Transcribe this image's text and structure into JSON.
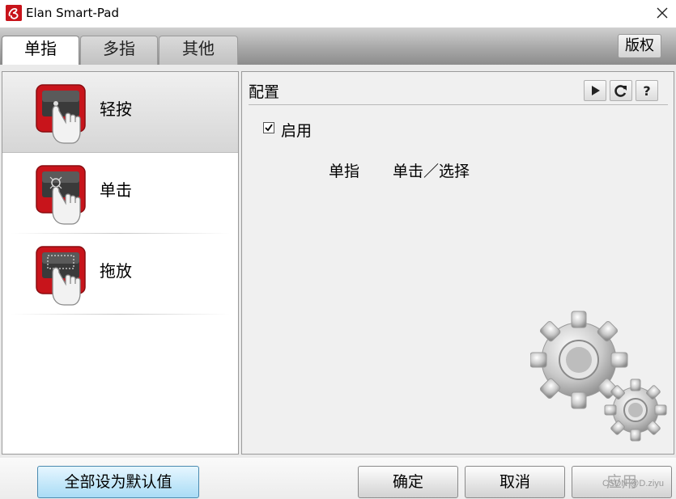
{
  "window": {
    "title": "Elan Smart-Pad",
    "app_icon": "elan-logo-icon",
    "close_icon": "close-icon"
  },
  "tabs": [
    {
      "label": "单指",
      "active": true
    },
    {
      "label": "多指",
      "active": false
    },
    {
      "label": "其他",
      "active": false
    }
  ],
  "copyright_label": "版权",
  "gesture_list": [
    {
      "label": "轻按",
      "icon": "touchpad-tap-icon",
      "selected": true
    },
    {
      "label": "单击",
      "icon": "touchpad-click-icon",
      "selected": false
    },
    {
      "label": "拖放",
      "icon": "touchpad-drag-icon",
      "selected": false
    }
  ],
  "config": {
    "title": "配置",
    "toolbar": [
      {
        "icon": "play-icon"
      },
      {
        "icon": "refresh-icon"
      },
      {
        "icon": "help-icon"
      }
    ],
    "enable_label": "启用",
    "enabled": true,
    "detail_gesture": "单指",
    "detail_action": "单击／选择",
    "illustration": "gears-icon"
  },
  "buttons": {
    "defaults_label": "全部设为默认值",
    "ok_label": "确定",
    "cancel_label": "取消",
    "apply_label": "应用"
  },
  "watermark": "CSDN @D.ziyu",
  "colors": {
    "accent_red": "#c8141b",
    "default_button": "#a9dcf5"
  }
}
